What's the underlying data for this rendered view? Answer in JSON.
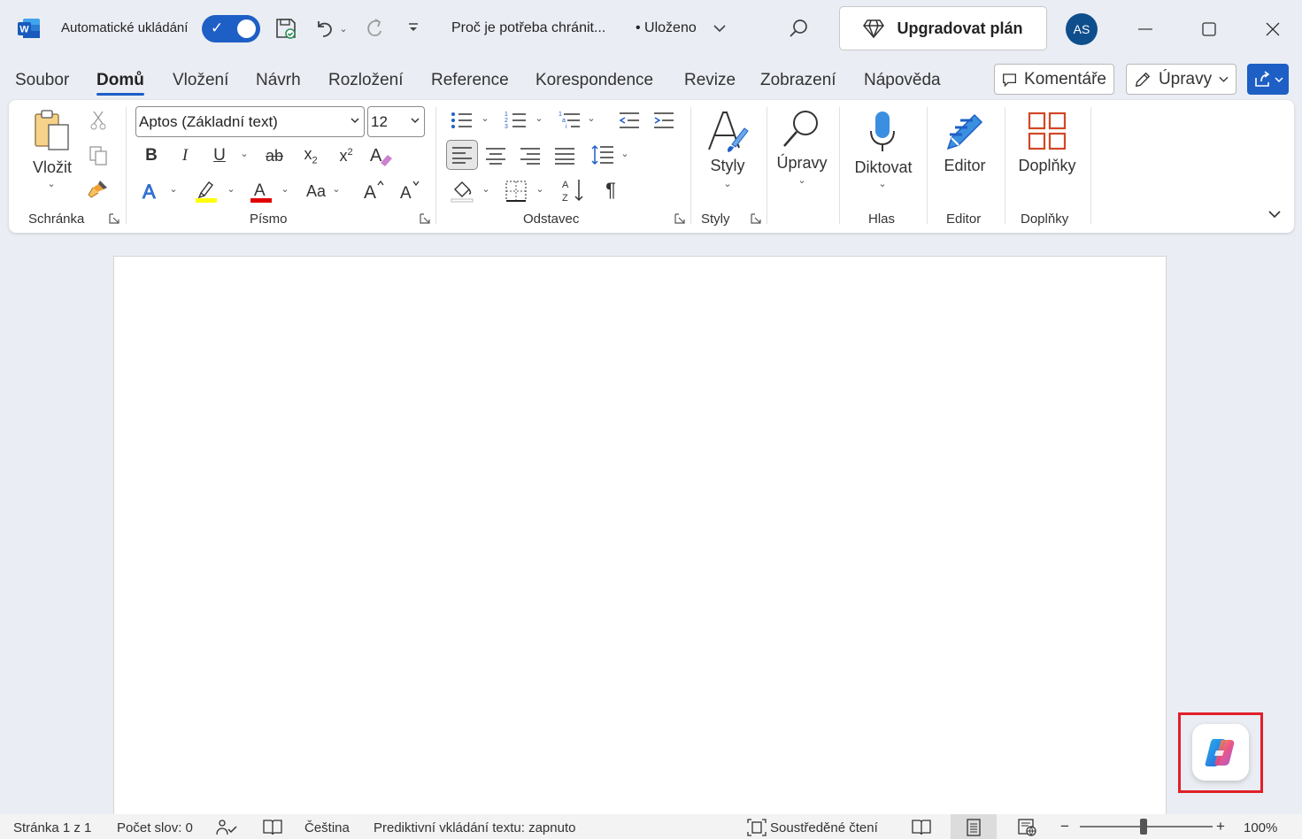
{
  "titlebar": {
    "autosave_label": "Automatické ukládání",
    "doc_title": "Proč je potřeba chránit...",
    "saved_status": "• Uloženo",
    "upgrade_label": "Upgradovat plán",
    "avatar_initials": "AS"
  },
  "tabs": [
    {
      "label": "Soubor"
    },
    {
      "label": "Domů",
      "active": true
    },
    {
      "label": "Vložení"
    },
    {
      "label": "Návrh"
    },
    {
      "label": "Rozložení"
    },
    {
      "label": "Reference"
    },
    {
      "label": "Korespondence"
    },
    {
      "label": "Revize"
    },
    {
      "label": "Zobrazení"
    },
    {
      "label": "Nápověda"
    }
  ],
  "actions": {
    "comments_label": "Komentáře",
    "editing_label": "Úpravy"
  },
  "ribbon": {
    "paste_label": "Vložit",
    "clipboard_group": "Schránka",
    "font_name": "Aptos (Základní text)",
    "font_size": "12",
    "font_group": "Písmo",
    "change_case_label": "Aa",
    "paragraph_group": "Odstavec",
    "styles_label": "Styly",
    "styles_group": "Styly",
    "editing_label": "Úpravy",
    "dictate_label": "Diktovat",
    "voice_group": "Hlas",
    "editor_label": "Editor",
    "editor_group": "Editor",
    "addins_label": "Doplňky",
    "addins_group": "Doplňky"
  },
  "statusbar": {
    "page": "Stránka 1 z 1",
    "words": "Počet slov: 0",
    "language": "Čeština",
    "predictive": "Prediktivní vkládání textu: zapnuto",
    "focus": "Soustředěné čtení",
    "zoom": "100%"
  },
  "colors": {
    "accent": "#1e5fc6",
    "highlight_color": "#ffff00",
    "font_color": "#e00000",
    "copilot_box": "#e0202a"
  }
}
